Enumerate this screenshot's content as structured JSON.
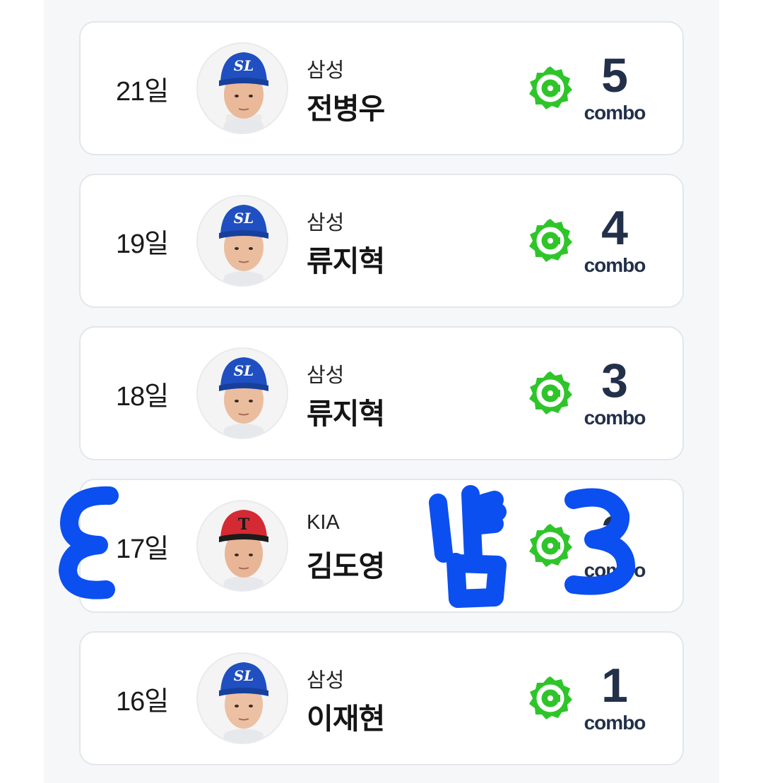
{
  "colors": {
    "badge_green": "#2fc52a",
    "combo_navy": "#23304a",
    "samsung_cap": "#1f4fc0",
    "kia_cap": "#d42a33",
    "scribble_blue": "#0b4ff0"
  },
  "streak": [
    {
      "day": "21일",
      "team": "삼성",
      "player": "전병우",
      "combo_count": "5",
      "combo_label": "combo",
      "cap_logo": "SL"
    },
    {
      "day": "19일",
      "team": "삼성",
      "player": "류지혁",
      "combo_count": "4",
      "combo_label": "combo",
      "cap_logo": "SL"
    },
    {
      "day": "18일",
      "team": "삼성",
      "player": "류지혁",
      "combo_count": "3",
      "combo_label": "combo",
      "cap_logo": "SL"
    },
    {
      "day": "17일",
      "team": "KIA",
      "player": "김도영",
      "combo_count": "2",
      "combo_label": "combo",
      "cap_logo": "T"
    },
    {
      "day": "16일",
      "team": "삼성",
      "player": "이재현",
      "combo_count": "1",
      "combo_label": "combo",
      "cap_logo": "SL"
    }
  ]
}
